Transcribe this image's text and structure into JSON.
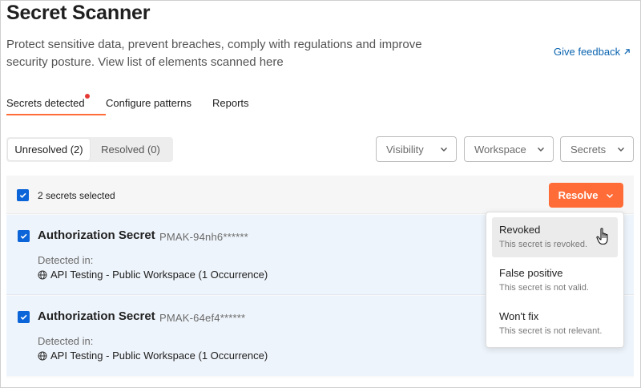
{
  "page": {
    "title": "Secret Scanner",
    "description": "Protect sensitive data, prevent breaches, comply with regulations and improve security posture. View list of elements scanned here",
    "feedback_label": "Give feedback"
  },
  "tabs": [
    {
      "label": "Secrets detected",
      "active": true,
      "notification": true
    },
    {
      "label": "Configure patterns",
      "active": false
    },
    {
      "label": "Reports",
      "active": false
    }
  ],
  "filters": {
    "segments": [
      {
        "label": "Unresolved (2)",
        "active": true
      },
      {
        "label": "Resolved (0)",
        "active": false
      }
    ],
    "dropdowns": [
      {
        "label": "Visibility"
      },
      {
        "label": "Workspace"
      },
      {
        "label": "Secrets"
      }
    ]
  },
  "selection": {
    "text": "2 secrets selected",
    "resolve_label": "Resolve",
    "checked": true
  },
  "secrets": [
    {
      "name": "Authorization Secret",
      "key": "PMAK-94nh6******",
      "detected_label": "Detected in:",
      "workspace": "API Testing - Public Workspace (1 Occurrence)",
      "checked": true
    },
    {
      "name": "Authorization Secret",
      "key": "PMAK-64ef4******",
      "detected_label": "Detected in:",
      "workspace": "API Testing - Public Workspace (1 Occurrence)",
      "checked": true
    }
  ],
  "resolve_menu": [
    {
      "label": "Revoked",
      "description": "This secret is revoked.",
      "hovered": true
    },
    {
      "label": "False positive",
      "description": "This secret is not valid."
    },
    {
      "label": "Won't fix",
      "description": "This secret is not relevant."
    }
  ],
  "colors": {
    "accent": "#ff6c37",
    "checkbox": "#0b64d8",
    "link": "#0b64b0",
    "notification_dot": "#e53935"
  },
  "icons": {
    "external_link": "arrow-up-right-icon",
    "chevron": "chevron-down-icon",
    "check": "check-icon",
    "globe": "globe-icon",
    "cursor": "hand-pointer-icon"
  }
}
